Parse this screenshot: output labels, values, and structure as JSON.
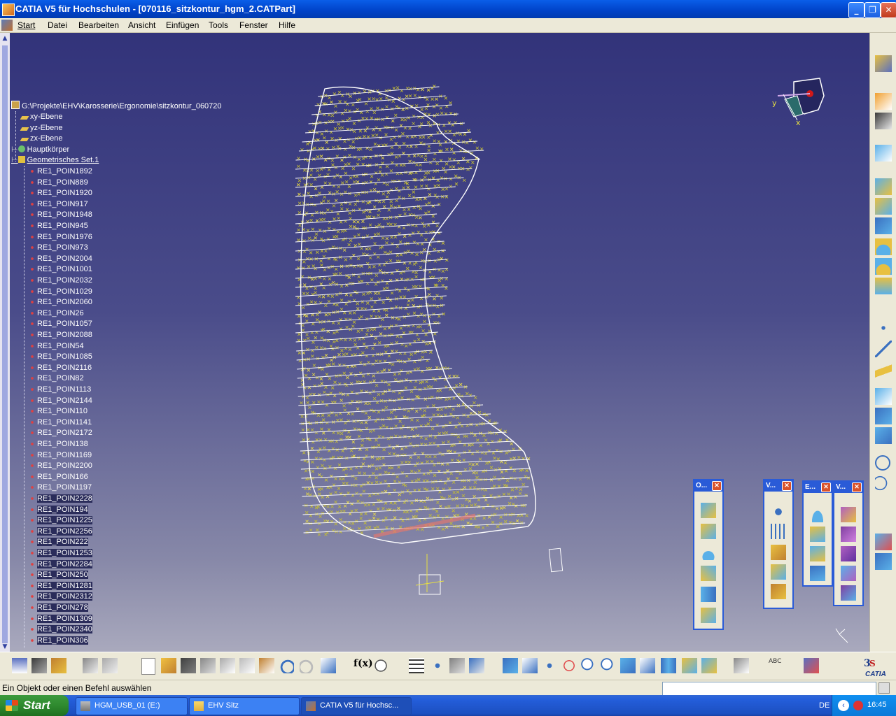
{
  "window": {
    "title": "CATIA V5 für Hochschulen - [070116_sitzkontur_hgm_2.CATPart]",
    "buttons": {
      "minimize": "_",
      "restore": "❐",
      "close": "✕"
    }
  },
  "menu": {
    "items": [
      "Start",
      "Datei",
      "Bearbeiten",
      "Ansicht",
      "Einfügen",
      "Tools",
      "Fenster",
      "Hilfe"
    ]
  },
  "tree": {
    "root": "G:\\Projekte\\EHV\\Karosserie\\Ergonomie\\sitzkontur_060720",
    "planes": [
      "xy-Ebene",
      "yz-Ebene",
      "zx-Ebene"
    ],
    "body": "Hauptkörper",
    "geoset": "Geometrisches Set.1",
    "points": [
      "RE1_POIN1892",
      "RE1_POIN889",
      "RE1_POIN1920",
      "RE1_POIN917",
      "RE1_POIN1948",
      "RE1_POIN945",
      "RE1_POIN1976",
      "RE1_POIN973",
      "RE1_POIN2004",
      "RE1_POIN1001",
      "RE1_POIN2032",
      "RE1_POIN1029",
      "RE1_POIN2060",
      "RE1_POIN26",
      "RE1_POIN1057",
      "RE1_POIN2088",
      "RE1_POIN54",
      "RE1_POIN1085",
      "RE1_POIN2116",
      "RE1_POIN82",
      "RE1_POIN1113",
      "RE1_POIN2144",
      "RE1_POIN110",
      "RE1_POIN1141",
      "RE1_POIN2172",
      "RE1_POIN138",
      "RE1_POIN1169",
      "RE1_POIN2200",
      "RE1_POIN166",
      "RE1_POIN1197",
      "RE1_POIN2228",
      "RE1_POIN194",
      "RE1_POIN1225",
      "RE1_POIN2256",
      "RE1_POIN222",
      "RE1_POIN1253",
      "RE1_POIN2284",
      "RE1_POIN250",
      "RE1_POIN1281",
      "RE1_POIN2312",
      "RE1_POIN278",
      "RE1_POIN1309",
      "RE1_POIN2340",
      "RE1_POIN306"
    ],
    "highlighted": [
      "RE1_POIN1309",
      "RE1_POIN2340",
      "RE1_POIN306",
      "RE1_POIN1281",
      "RE1_POIN2312",
      "RE1_POIN278",
      "RE1_POIN2228",
      "RE1_POIN194",
      "RE1_POIN1225",
      "RE1_POIN2256",
      "RE1_POIN222",
      "RE1_POIN1253",
      "RE1_POIN2284",
      "RE1_POIN250"
    ]
  },
  "palettes": [
    {
      "label": "O..."
    },
    {
      "label": "V..."
    },
    {
      "label": "E..."
    },
    {
      "label": "V..."
    }
  ],
  "compass": {
    "axis_x": "x",
    "axis_y": "y"
  },
  "status": {
    "message": "Ein Objekt oder einen Befehl auswählen",
    "command_value": ""
  },
  "taskbar": {
    "start": "Start",
    "tasks": [
      "HGM_USB_01 (E:)",
      "EHV Sitz",
      "CATIA V5 für Hochsc..."
    ],
    "lang": "DE",
    "clock": "16:45"
  },
  "logo": "CATIA",
  "colors": {
    "accent": "#2a5bd7",
    "cloud": "#d8d020",
    "curves": "#ffffff",
    "viewport_top": "#32337a",
    "viewport_bottom": "#a9a9bd"
  }
}
